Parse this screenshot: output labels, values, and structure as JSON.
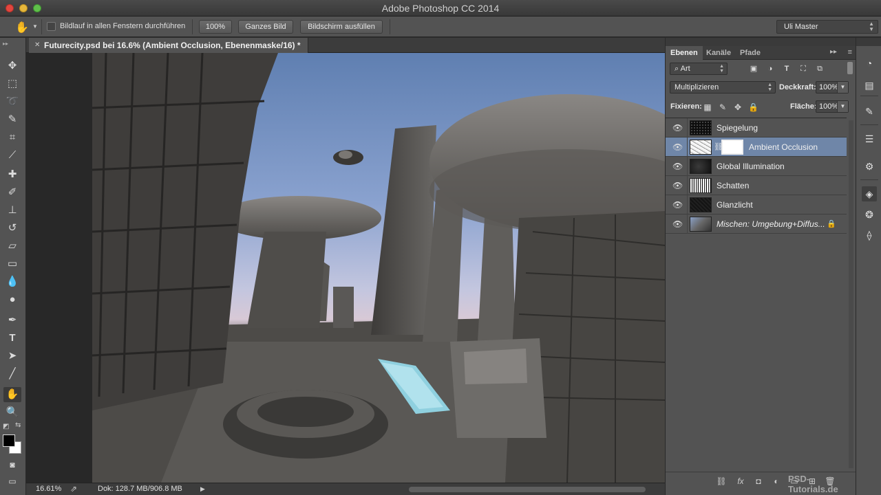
{
  "app": {
    "title": "Adobe Photoshop CC 2014"
  },
  "options_bar": {
    "tool_icon": "hand-icon",
    "scroll_all_label": "Bildlauf in allen Fenstern durchführen",
    "btn_100": "100%",
    "btn_fit": "Ganzes Bild",
    "btn_fill": "Bildschirm ausfüllen",
    "workspace": "Uli Master"
  },
  "document": {
    "tab_title": "Futurecity.psd bei 16.6% (Ambient Occlusion, Ebenenmaske/16) *"
  },
  "status": {
    "zoom": "16.61%",
    "doc_info": "Dok: 128.7 MB/906.8 MB"
  },
  "panel": {
    "tabs": [
      "Ebenen",
      "Kanäle",
      "Pfade"
    ],
    "filter_kind": "Art",
    "blend_mode": "Multiplizieren",
    "opacity_label": "Deckkraft:",
    "opacity_value": "100%",
    "lock_label": "Fixieren:",
    "fill_label": "Fläche:",
    "fill_value": "100%",
    "layers": [
      {
        "name": "Spiegelung"
      },
      {
        "name": "Ambient Occlusion"
      },
      {
        "name": "Global Illumination"
      },
      {
        "name": "Schatten"
      },
      {
        "name": "Glanzlicht"
      },
      {
        "name": "Mischen: Umgebung+Diffus..."
      }
    ],
    "watermark": "PSD-Tutorials.de"
  },
  "colors": {
    "selected_layer": "#6f86a8",
    "panel_bg": "#535353",
    "canvas_bg": "#282828"
  }
}
